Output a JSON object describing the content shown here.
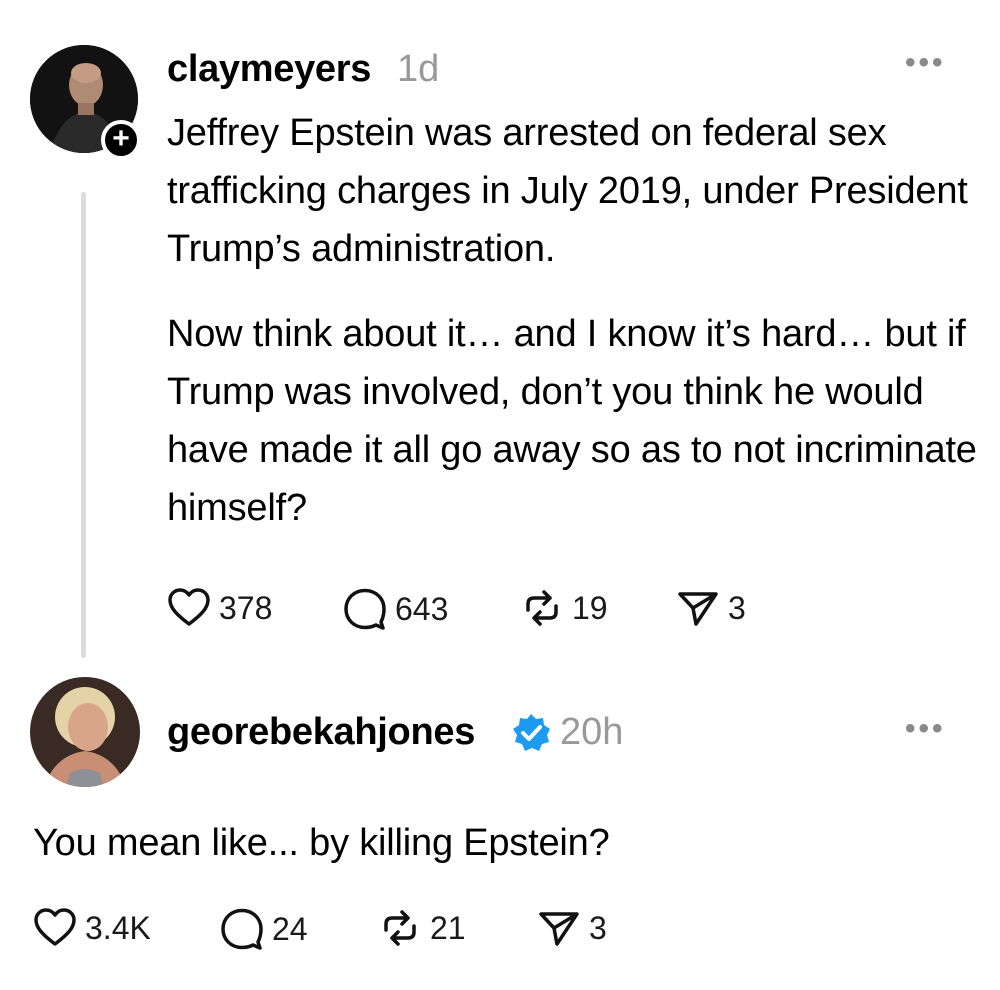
{
  "posts": [
    {
      "username": "claymeyers",
      "time": "1d",
      "paragraphs": [
        "Jeffrey Epstein was arrested on federal sex trafficking charges in July 2019, under President Trump’s administration.",
        "Now think about it… and I know it’s hard… but if Trump was involved, don’t you think he would have made it all go away so as to not incriminate himself?"
      ],
      "likes": "378",
      "replies": "643",
      "reposts": "19",
      "shares": "3",
      "icons": [
        "avatar",
        "follow-plus-icon",
        "more-icon",
        "heart-icon",
        "comment-icon",
        "repost-icon",
        "share-icon"
      ]
    },
    {
      "username": "georebekahjones",
      "verified": true,
      "time": "20h",
      "text": "You mean like... by killing Epstein?",
      "likes": "3.4K",
      "replies": "24",
      "reposts": "21",
      "shares": "3",
      "icons": [
        "avatar",
        "verified-badge-icon",
        "more-icon",
        "heart-icon",
        "comment-icon",
        "repost-icon",
        "share-icon"
      ]
    }
  ],
  "colors": {
    "text": "#000000",
    "muted": "#999999",
    "verified": "#1d9bf0",
    "thread_line": "#dcdcdc"
  }
}
